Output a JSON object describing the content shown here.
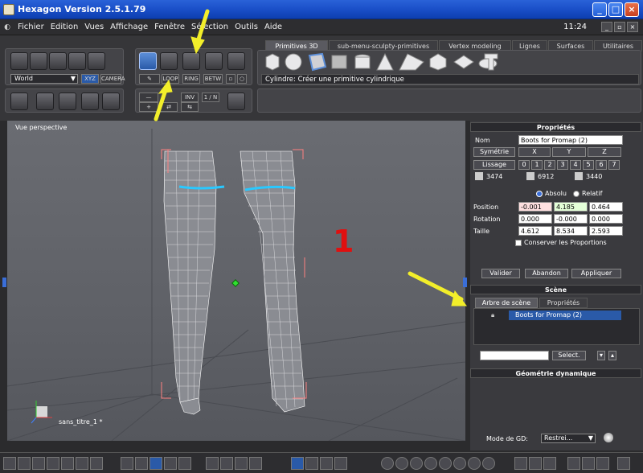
{
  "window": {
    "title": "Hexagon Version 2.5.1.79",
    "clock": "11:24"
  },
  "menu": [
    "Fichier",
    "Edition",
    "Vues",
    "Affichage",
    "Fenêtre",
    "Sélection",
    "Outils",
    "Aide"
  ],
  "toolbar": {
    "world_select": "World",
    "xyz": "XYZ",
    "camera": "CAMERA",
    "loop": "LOOP",
    "ring": "RING",
    "betw": "BETW",
    "inv": "INV",
    "one_n": "1 / N",
    "status": "Cylindre: Créer une primitive cylindrique"
  },
  "tabs": [
    "Primitives 3D",
    "sub-menu-sculpty-primitives",
    "Vertex modeling",
    "Lignes",
    "Surfaces",
    "Utilitaires"
  ],
  "viewport": {
    "label": "Vue perspective",
    "annotation": "1",
    "filename": "sans_titre_1 *"
  },
  "properties": {
    "header": "Propriétés",
    "name_label": "Nom",
    "name_value": "Boots for Promap (2)",
    "symmetry": "Symétrie",
    "x": "X",
    "y": "Y",
    "z": "Z",
    "smoothing": "Lissage",
    "smooth_levels": [
      "0",
      "1",
      "2",
      "3",
      "4",
      "5",
      "6",
      "7"
    ],
    "counts": [
      "3474",
      "6912",
      "3440"
    ],
    "absolu": "Absolu",
    "relatif": "Relatif",
    "position_label": "Position",
    "position": [
      "-0.001",
      "4.185",
      "0.464"
    ],
    "rotation_label": "Rotation",
    "rotation": [
      "0.000",
      "-0.000",
      "0.000"
    ],
    "size_label": "Taille",
    "size": [
      "4.612",
      "8.534",
      "2.593"
    ],
    "keep_proportions": "Conserver les Proportions",
    "validate": "Valider",
    "cancel": "Abandon",
    "apply": "Appliquer"
  },
  "scene": {
    "header": "Scène",
    "tab_tree": "Arbre de scène",
    "tab_props": "Propriétés",
    "item": "Boots for Promap (2)",
    "select": "Select."
  },
  "dyn_geo": {
    "header": "Géométrie dynamique",
    "mode_label": "Mode de GD:",
    "mode_value": "Restrei..."
  },
  "colors": {
    "accent": "#2a62d8",
    "annotation_red": "#e01010",
    "arrow_yellow": "#f2ee2a",
    "selection_cyan": "#29c8ff"
  }
}
